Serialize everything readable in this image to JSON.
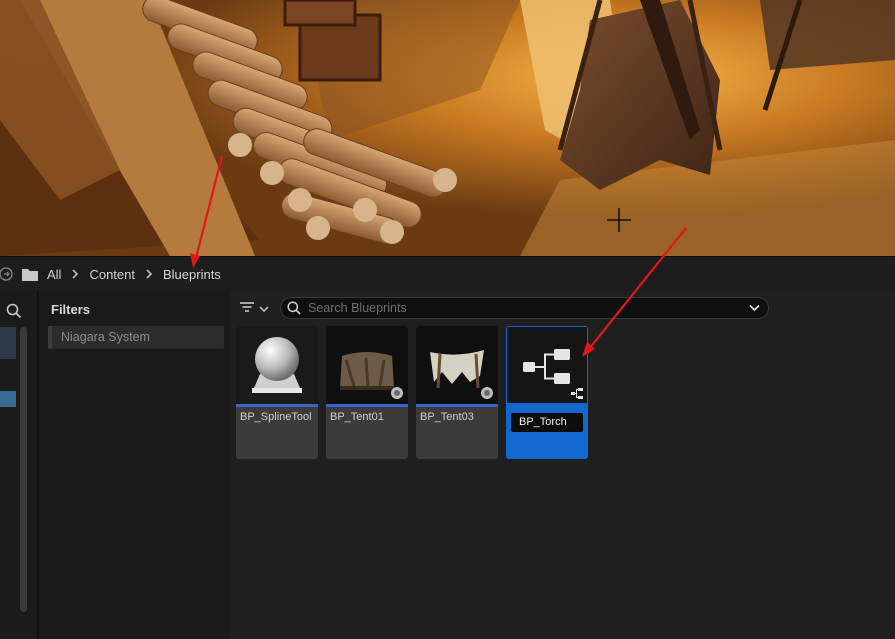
{
  "breadcrumb": {
    "items": [
      "All",
      "Content",
      "Blueprints"
    ]
  },
  "filters": {
    "title": "Filters",
    "chips": [
      "Niagara System"
    ]
  },
  "search": {
    "placeholder": "Search Blueprints"
  },
  "assets": [
    {
      "name": "BP_SplineTool",
      "thumb": "sphere-icon",
      "selected": false
    },
    {
      "name": "BP_Tent01",
      "thumb": "tent-icon",
      "selected": false
    },
    {
      "name": "BP_Tent03",
      "thumb": "tent-icon",
      "selected": false
    },
    {
      "name": "BP_Torch",
      "thumb": "blueprint-class-icon",
      "selected": true,
      "renaming": true
    }
  ],
  "colors": {
    "selection": "#1368d0",
    "annotation": "#e01818",
    "asset_strip": "#3c64c4"
  },
  "icons": [
    "history-icon",
    "folder-icon",
    "chevron-right-icon",
    "search-icon",
    "filter-icon",
    "chevron-down-icon",
    "crosshair-icon",
    "arrow-annotation"
  ]
}
